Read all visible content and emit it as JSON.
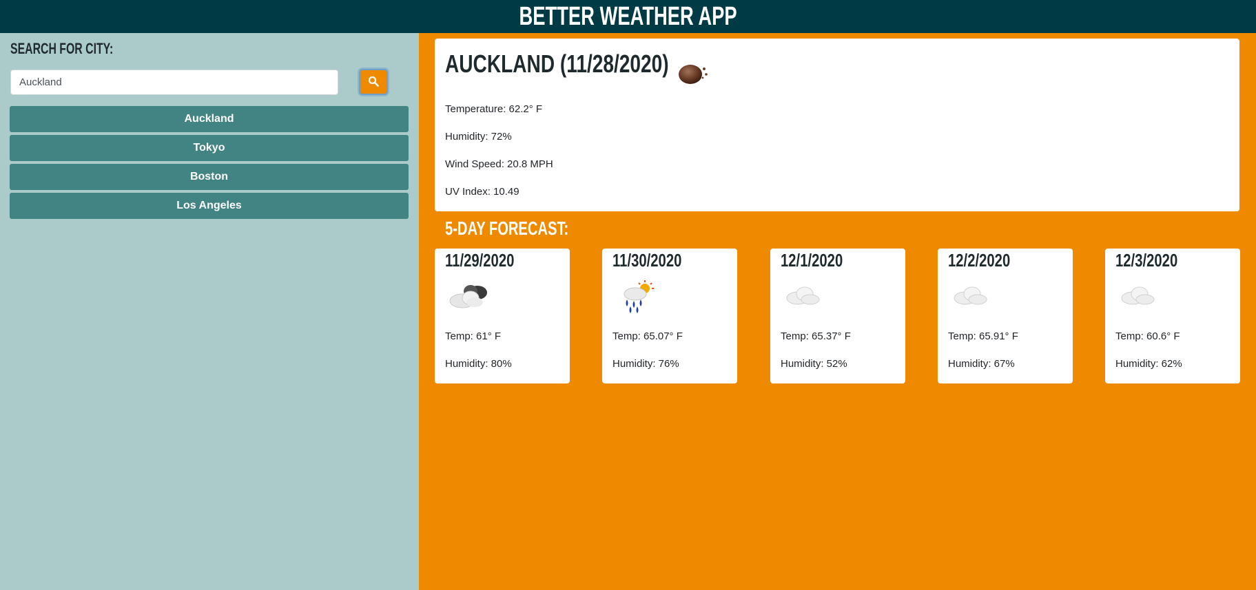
{
  "app": {
    "title": "Better Weather App"
  },
  "search": {
    "label": "Search for City:",
    "value": "Auckland",
    "button_icon": "search-icon"
  },
  "history": [
    "Auckland",
    "Tokyo",
    "Boston",
    "Los Angeles"
  ],
  "current": {
    "title": "Auckland (11/28/2020)",
    "icon": "brown-dust-icon",
    "temperature": "Temperature: 62.2° F",
    "humidity": "Humidity: 72%",
    "wind": "Wind Speed: 20.8 MPH",
    "uv": "UV Index: 10.49"
  },
  "forecast": {
    "heading": "5-Day Forecast:",
    "days": [
      {
        "date": "11/29/2020",
        "icon": "partly-cloudy-dark-icon",
        "temp": "Temp: 61° F",
        "humidity": "Humidity: 80%"
      },
      {
        "date": "11/30/2020",
        "icon": "sun-rain-icon",
        "temp": "Temp: 65.07° F",
        "humidity": "Humidity: 76%"
      },
      {
        "date": "12/1/2020",
        "icon": "cloud-icon",
        "temp": "Temp: 65.37° F",
        "humidity": "Humidity: 52%"
      },
      {
        "date": "12/2/2020",
        "icon": "cloud-icon",
        "temp": "Temp: 65.91° F",
        "humidity": "Humidity: 67%"
      },
      {
        "date": "12/3/2020",
        "icon": "cloud-icon",
        "temp": "Temp: 60.6° F",
        "humidity": "Humidity: 62%"
      }
    ]
  },
  "colors": {
    "header": "#003b45",
    "sidebar": "#abcbcb",
    "accent": "#ef8900",
    "history_button": "#428483"
  }
}
